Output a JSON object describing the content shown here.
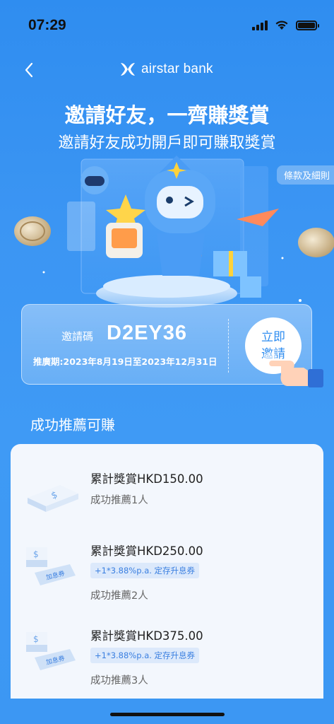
{
  "status_bar": {
    "time": "07:29"
  },
  "nav": {
    "brand_name": "airstar bank"
  },
  "header": {
    "headline": "邀請好友，一齊賺獎賞",
    "subheadline": "邀請好友成功開戶即可賺取獎賞",
    "terms_link": "條款及細則"
  },
  "invite": {
    "code_label": "邀請碼",
    "code": "D2EY36",
    "promo_period": "推廣期:2023年8月19日至2023年12月31日",
    "button_line1": "立即",
    "button_line2": "邀請"
  },
  "rewards": {
    "section_title": "成功推薦可賺",
    "coupon_text": "加息券",
    "items": [
      {
        "amount": "累計獎賞HKD150.00",
        "tag": "",
        "count": "成功推薦1人"
      },
      {
        "amount": "累計獎賞HKD250.00",
        "tag": "+1*3.88%p.a. 定存升息券",
        "count": "成功推薦2人"
      },
      {
        "amount": "累計獎賞HKD375.00",
        "tag": "+1*3.88%p.a. 定存升息券",
        "count": "成功推薦3人"
      }
    ]
  },
  "colors": {
    "background": "#3b95f3",
    "card": "#f3f7fd",
    "accent": "#2f8df0",
    "tag_bg": "#dce9fb"
  }
}
